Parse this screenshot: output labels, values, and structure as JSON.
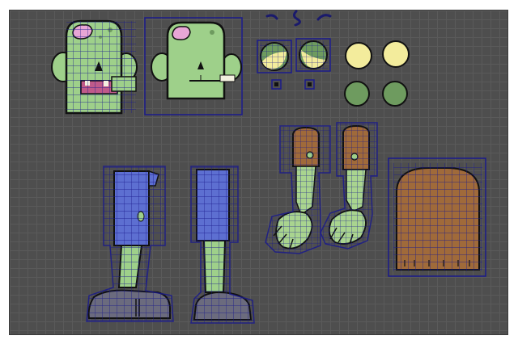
{
  "window": {
    "title": ""
  },
  "palette": {
    "viewport_bg": "#4e4e4e",
    "grid_line": "#5a5a5a",
    "uv_wire": "#1a1a8c",
    "skin_green": "#9ed08a",
    "skin_dark_green": "#6e9b5f",
    "brain_pink": "#e8a6d6",
    "eye_yellow": "#f3ec9c",
    "pants_blue": "#5d6fd1",
    "boot_gray": "#6b6b7e",
    "hand_green": "#a9d48f",
    "sleeve_brown": "#a06a3a",
    "outline": "#111111"
  },
  "uv_islands": [
    {
      "name": "zombie-head-uv-textured",
      "icon": "zombie-head"
    },
    {
      "name": "zombie-head-uv-duplicate",
      "icon": "zombie-head"
    },
    {
      "name": "eyebrow-strokes",
      "icon": "eyebrow"
    },
    {
      "name": "eyeball-uv-pair",
      "icon": "eyeball"
    },
    {
      "name": "iris-dots",
      "icon": "dot"
    },
    {
      "name": "eyeball-yellow-pair",
      "icon": "eyeball"
    },
    {
      "name": "eyeball-green-pair",
      "icon": "eyeball"
    },
    {
      "name": "left-leg-uv",
      "icon": "leg"
    },
    {
      "name": "right-leg-uv",
      "icon": "leg"
    },
    {
      "name": "left-arm-uv",
      "icon": "arm"
    },
    {
      "name": "right-arm-uv",
      "icon": "arm"
    },
    {
      "name": "torso-back-uv",
      "icon": "torso"
    }
  ]
}
